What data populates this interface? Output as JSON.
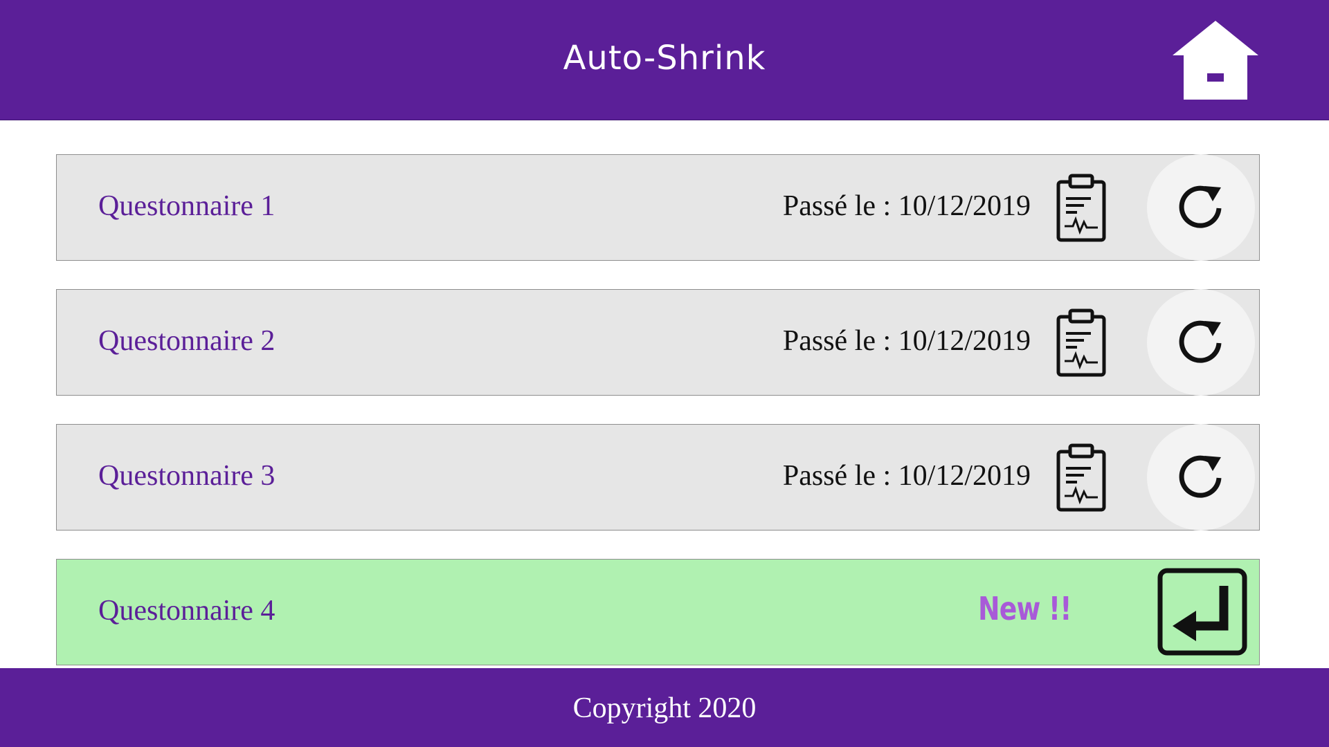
{
  "header": {
    "title": "Auto-Shrink",
    "home_icon": "home-icon"
  },
  "questionnaires": [
    {
      "title": "Questonnaire 1",
      "status": "Passé le : 10/12/2019",
      "icons": [
        "clipboard-report-icon",
        "reload-icon"
      ]
    },
    {
      "title": "Questonnaire 2",
      "status": "Passé le : 10/12/2019",
      "icons": [
        "clipboard-report-icon",
        "reload-icon"
      ]
    },
    {
      "title": "Questonnaire 3",
      "status": "Passé le : 10/12/2019",
      "icons": [
        "clipboard-report-icon",
        "reload-icon"
      ]
    },
    {
      "title": "Questonnaire 4",
      "status": "New !!",
      "icons": [
        "enter-icon"
      ]
    }
  ],
  "footer": {
    "copyright": "Copyright 2020"
  },
  "colors": {
    "brand": "#5b1f98",
    "row_bg": "#e6e6e6",
    "new_row_bg": "#b0f1b1",
    "new_badge": "#a85ad8"
  }
}
